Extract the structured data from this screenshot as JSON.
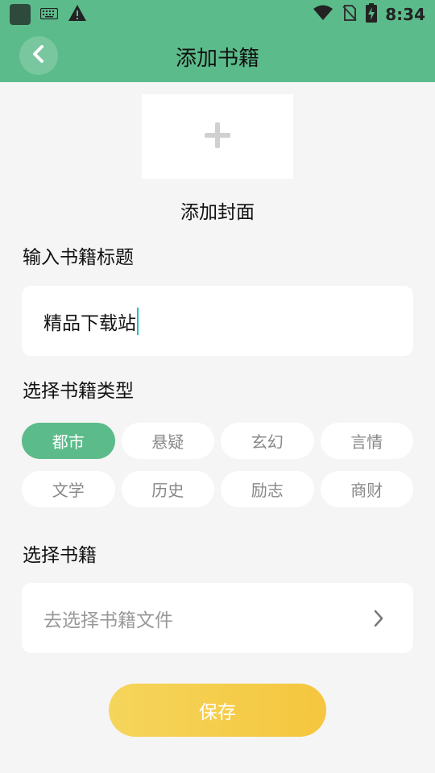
{
  "status_bar": {
    "time": "8:34",
    "icons": [
      "app-icon",
      "keyboard-icon",
      "warning-icon",
      "wifi-icon",
      "no-sim-icon",
      "battery-charging-icon"
    ]
  },
  "header": {
    "title": "添加书籍",
    "back_icon": "chevron-left-icon"
  },
  "cover": {
    "icon": "plus-icon",
    "label": "添加封面"
  },
  "title_section": {
    "label": "输入书籍标题",
    "input_value": "精品下载站"
  },
  "type_section": {
    "label": "选择书籍类型",
    "selected": "都市",
    "tags": [
      {
        "label": "都市"
      },
      {
        "label": "悬疑"
      },
      {
        "label": "玄幻"
      },
      {
        "label": "言情"
      },
      {
        "label": "文学"
      },
      {
        "label": "历史"
      },
      {
        "label": "励志"
      },
      {
        "label": "商财"
      }
    ]
  },
  "file_section": {
    "label": "选择书籍",
    "placeholder": "去选择书籍文件",
    "chevron_icon": "chevron-right-icon"
  },
  "save_button": {
    "label": "保存"
  },
  "colors": {
    "accent": "#5cbb8a",
    "save_gradient_start": "#f5d55b",
    "save_gradient_end": "#f5c63e",
    "caret": "#21c3b4"
  }
}
